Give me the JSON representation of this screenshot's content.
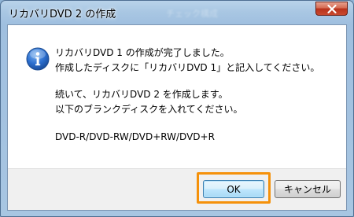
{
  "window": {
    "title": "リカバリDVD 2 の作成",
    "background_hint": "チェック構成"
  },
  "dialog": {
    "icon": "info-icon",
    "message_line1": "リカバリDVD 1 の作成が完了しました。",
    "message_line2": "作成したディスクに「リカバリDVD 1」と記入してください。",
    "message_line3": "続いて、リカバリDVD 2 を作成します。",
    "message_line4": "以下のブランクディスクを入れてください。",
    "message_line5": "DVD-R/DVD-RW/DVD+RW/DVD+R"
  },
  "buttons": {
    "ok_label": "OK",
    "cancel_label": "キャンセル"
  },
  "colors": {
    "highlight": "#f5910a",
    "info_icon": "#1f5fb8",
    "close_button": "#c9492f"
  }
}
